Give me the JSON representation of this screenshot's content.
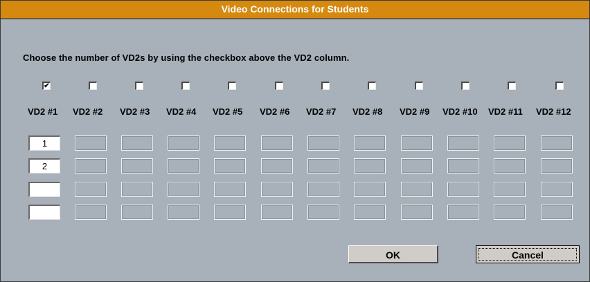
{
  "dialog": {
    "title": "Video Connections for Students",
    "instruction": "Choose the number of VD2s by using the checkbox above the VD2 column."
  },
  "columns": [
    {
      "label": "VD2 #1",
      "checked": true,
      "active": true
    },
    {
      "label": "VD2 #2",
      "checked": false,
      "active": false
    },
    {
      "label": "VD2 #3",
      "checked": false,
      "active": false
    },
    {
      "label": "VD2 #4",
      "checked": false,
      "active": false
    },
    {
      "label": "VD2 #5",
      "checked": false,
      "active": false
    },
    {
      "label": "VD2 #6",
      "checked": false,
      "active": false
    },
    {
      "label": "VD2 #7",
      "checked": false,
      "active": false
    },
    {
      "label": "VD2 #8",
      "checked": false,
      "active": false
    },
    {
      "label": "VD2 #9",
      "checked": false,
      "active": false
    },
    {
      "label": "VD2 #10",
      "checked": false,
      "active": false
    },
    {
      "label": "VD2 #11",
      "checked": false,
      "active": false
    },
    {
      "label": "VD2 #12",
      "checked": false,
      "active": false
    }
  ],
  "grid": {
    "col1_values": [
      "1",
      "2",
      "",
      ""
    ],
    "rows": 4
  },
  "buttons": {
    "ok": "OK",
    "cancel": "Cancel"
  },
  "colors": {
    "title_bar": "#d6890f",
    "dialog_bg": "#a8b0b9",
    "button_bg": "#d0ccc7"
  },
  "check_glyph": "✔"
}
